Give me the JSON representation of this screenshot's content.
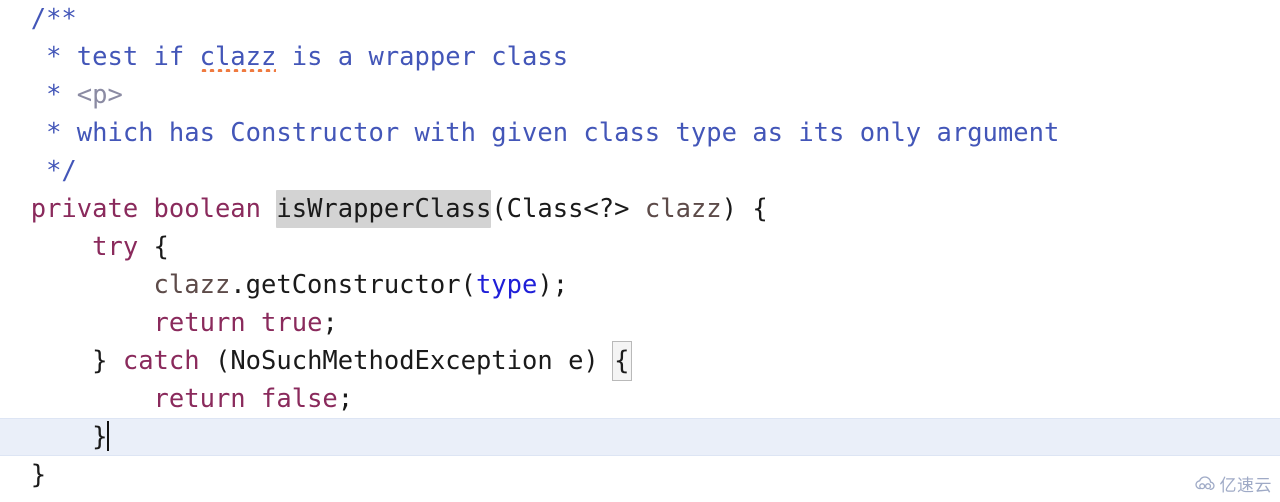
{
  "editor": {
    "language": "Java",
    "font_size_px": 25,
    "line_height_px": 38,
    "background": "#ffffff",
    "current_line_background": "#eaeff9",
    "occurrence_highlight_background": "#d3d3d3",
    "bracket_match_outline": "#b9b9b9",
    "caret_color": "#111111",
    "colors": {
      "comment": "#4356b8",
      "comment_html_tag": "#8b8ba3",
      "keyword": "#8a2a5c",
      "field": "#1f1fd8",
      "parameter": "#5d4b49",
      "plain": "#1a1a1a",
      "spellcheck_squiggle": "#ef7a40"
    },
    "lines": [
      {
        "n": 1,
        "indent": "  ",
        "text": "/**"
      },
      {
        "n": 2,
        "indent": "   ",
        "text": "* test if clazz is a wrapper class"
      },
      {
        "n": 3,
        "indent": "   ",
        "text": "* <p>"
      },
      {
        "n": 4,
        "indent": "   ",
        "text": "* which has Constructor with given class type as its only argument"
      },
      {
        "n": 5,
        "indent": "   ",
        "text": "*/"
      },
      {
        "n": 6,
        "indent": "  ",
        "text": "private boolean isWrapperClass(Class<?> clazz) {"
      },
      {
        "n": 7,
        "indent": "      ",
        "text": "try {"
      },
      {
        "n": 8,
        "indent": "          ",
        "text": "clazz.getConstructor(type);"
      },
      {
        "n": 9,
        "indent": "          ",
        "text": "return true;"
      },
      {
        "n": 10,
        "indent": "      ",
        "text": "} catch (NoSuchMethodException e) {"
      },
      {
        "n": 11,
        "indent": "          ",
        "text": "return false;"
      },
      {
        "n": 12,
        "indent": "      ",
        "text": "}"
      },
      {
        "n": 13,
        "indent": "  ",
        "text": "}"
      }
    ],
    "tokens": {
      "l1_comment_open": "/**",
      "l2_star": "* test if ",
      "l2_clazz": "clazz",
      "l2_rest": " is a wrapper class",
      "l3_star": "* ",
      "l3_ptag": "<p>",
      "l4_text": "* which has Constructor with given class type as its only argument",
      "l5_close": "*/",
      "l6_kw_private": "private",
      "l6_kw_boolean": "boolean",
      "l6_method": "isWrapperClass",
      "l6_open_paren": "(",
      "l6_type": "Class<?>",
      "l6_param": "clazz",
      "l6_close_paren": ")",
      "l6_brace": "{",
      "l7_kw_try": "try",
      "l7_brace": "{",
      "l8_var": "clazz",
      "l8_call": ".getConstructor(",
      "l8_field": "type",
      "l8_tail": ");",
      "l9_kw_return": "return",
      "l9_kw_true": "true",
      "l9_semi": ";",
      "l10_close_brace": "}",
      "l10_kw_catch": "catch",
      "l10_exception": "(NoSuchMethodException e)",
      "l10_brace": "{",
      "l11_kw_return": "return",
      "l11_kw_false": "false",
      "l11_semi": ";",
      "l12_brace": "}",
      "l13_brace": "}"
    }
  },
  "watermark": {
    "text": "亿速云",
    "icon": "cloud-logo-icon",
    "color": "#9aa6c4"
  }
}
